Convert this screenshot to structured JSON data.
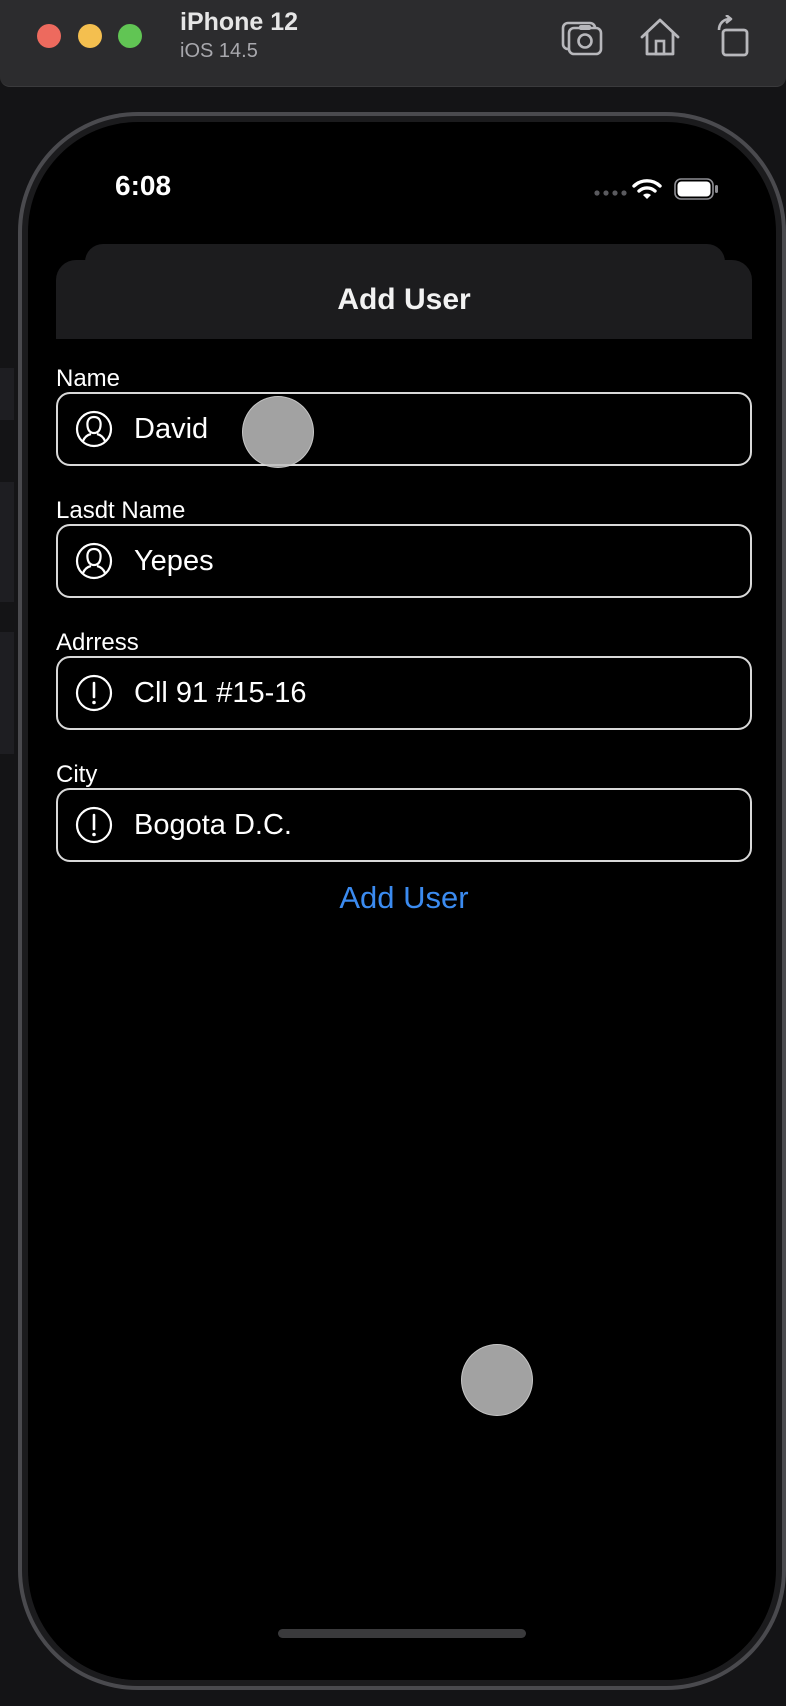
{
  "simulator": {
    "device_name": "iPhone 12",
    "os_version": "iOS 14.5",
    "toolbar_icons": [
      "screenshot-icon",
      "home-icon",
      "rotate-icon"
    ]
  },
  "status_bar": {
    "time": "6:08",
    "icons": [
      "signal-dots-icon",
      "wifi-icon",
      "battery-icon"
    ]
  },
  "nav": {
    "title": "Add User"
  },
  "form": {
    "fields": [
      {
        "label": "Name",
        "value": "David",
        "icon": "person-icon"
      },
      {
        "label": "Lasdt Name",
        "value": "Yepes",
        "icon": "person-icon"
      },
      {
        "label": "Adrress",
        "value": "Cll 91 #15-16",
        "icon": "exclamation-icon"
      },
      {
        "label": "City",
        "value": "Bogota D.C.",
        "icon": "exclamation-icon"
      }
    ],
    "submit_label": "Add User"
  },
  "colors": {
    "accent": "#3b8bf0",
    "background": "#000000",
    "nav_bar": "#1c1c1e"
  }
}
